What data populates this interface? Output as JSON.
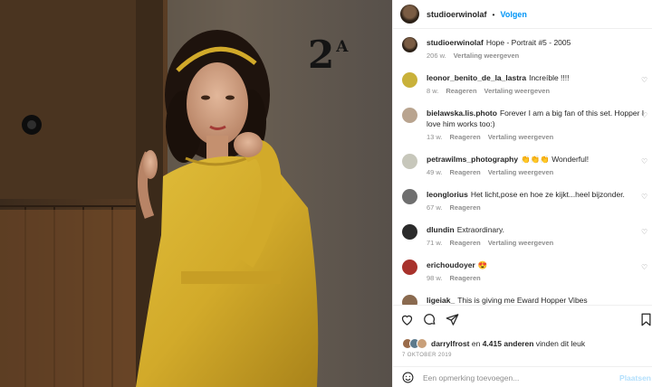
{
  "photo": {
    "room_number": "2",
    "room_letter": "A"
  },
  "header": {
    "username": "studioerwinolaf",
    "separator": "•",
    "follow_label": "Volgen"
  },
  "caption": {
    "username": "studioerwinolaf",
    "text": "Hope - Portrait #5 - 2005",
    "age": "206 w.",
    "translate": "Vertaling weergeven"
  },
  "comments": [
    {
      "username": "leonor_benito_de_la_lastra",
      "text": "Increíble !!!!",
      "age": "8 w.",
      "reply": "Reageren",
      "translate": "Vertaling weergeven",
      "avatar_color": "#c9b13a"
    },
    {
      "username": "bielawska.lis.photo",
      "text": "Forever I am a big fan of this set. Hopper I love him works too:)",
      "age": "13 w.",
      "reply": "Reageren",
      "translate": "Vertaling weergeven",
      "avatar_color": "#b9a48f"
    },
    {
      "username": "petrawilms_photography",
      "text": "👏👏👏 Wonderful!",
      "age": "49 w.",
      "reply": "Reageren",
      "translate": "Vertaling weergeven",
      "avatar_color": "#c7c7bb"
    },
    {
      "username": "leonglorius",
      "text": "Het licht,pose en hoe ze kijkt...heel bijzonder.",
      "age": "67 w.",
      "reply": "Reageren",
      "translate": "",
      "avatar_color": "#6f6f6f"
    },
    {
      "username": "dlundin",
      "text": "Extraordinary.",
      "age": "71 w.",
      "reply": "Reageren",
      "translate": "Vertaling weergeven",
      "avatar_color": "#2b2b2b"
    },
    {
      "username": "erichoudoyer",
      "text": "😍",
      "age": "98 w.",
      "reply": "Reageren",
      "translate": "",
      "avatar_color": "#a8322c"
    },
    {
      "username": "ligeiak_",
      "text": "This is giving me Eward Hopper Vibes",
      "age": "",
      "reply": "",
      "translate": "",
      "avatar_color": "#8a6a4f"
    }
  ],
  "likes": {
    "user": "darrylfrost",
    "joiner": " en ",
    "count": "4.415 anderen",
    "suffix": " vinden dit leuk"
  },
  "date": "7 OKTOBER 2019",
  "add_comment": {
    "placeholder": "Een opmerking toevoegen...",
    "post_label": "Plaatsen"
  },
  "icons": [
    "heart-icon",
    "comment-icon",
    "share-icon",
    "bookmark-icon",
    "emoji-icon"
  ]
}
